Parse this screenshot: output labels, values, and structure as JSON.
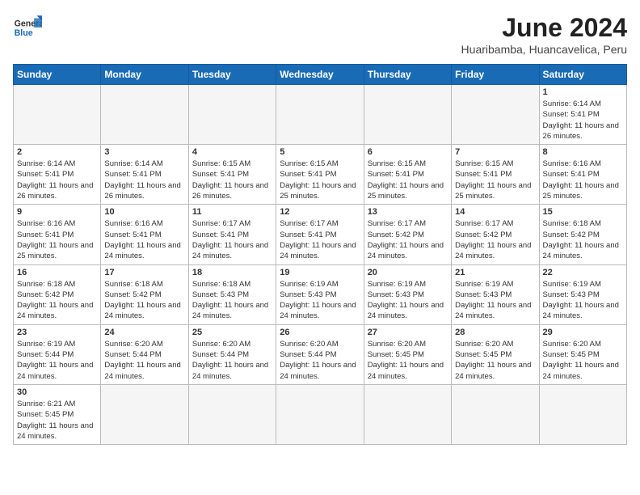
{
  "header": {
    "logo_general": "General",
    "logo_blue": "Blue",
    "month_year": "June 2024",
    "location": "Huaribamba, Huancavelica, Peru"
  },
  "weekdays": [
    "Sunday",
    "Monday",
    "Tuesday",
    "Wednesday",
    "Thursday",
    "Friday",
    "Saturday"
  ],
  "weeks": [
    [
      {
        "day": "",
        "info": ""
      },
      {
        "day": "",
        "info": ""
      },
      {
        "day": "",
        "info": ""
      },
      {
        "day": "",
        "info": ""
      },
      {
        "day": "",
        "info": ""
      },
      {
        "day": "",
        "info": ""
      },
      {
        "day": "1",
        "info": "Sunrise: 6:14 AM\nSunset: 5:41 PM\nDaylight: 11 hours\nand 26 minutes."
      }
    ],
    [
      {
        "day": "2",
        "info": "Sunrise: 6:14 AM\nSunset: 5:41 PM\nDaylight: 11 hours\nand 26 minutes."
      },
      {
        "day": "3",
        "info": "Sunrise: 6:14 AM\nSunset: 5:41 PM\nDaylight: 11 hours\nand 26 minutes."
      },
      {
        "day": "4",
        "info": "Sunrise: 6:15 AM\nSunset: 5:41 PM\nDaylight: 11 hours\nand 26 minutes."
      },
      {
        "day": "5",
        "info": "Sunrise: 6:15 AM\nSunset: 5:41 PM\nDaylight: 11 hours\nand 25 minutes."
      },
      {
        "day": "6",
        "info": "Sunrise: 6:15 AM\nSunset: 5:41 PM\nDaylight: 11 hours\nand 25 minutes."
      },
      {
        "day": "7",
        "info": "Sunrise: 6:15 AM\nSunset: 5:41 PM\nDaylight: 11 hours\nand 25 minutes."
      },
      {
        "day": "8",
        "info": "Sunrise: 6:16 AM\nSunset: 5:41 PM\nDaylight: 11 hours\nand 25 minutes."
      }
    ],
    [
      {
        "day": "9",
        "info": "Sunrise: 6:16 AM\nSunset: 5:41 PM\nDaylight: 11 hours\nand 25 minutes."
      },
      {
        "day": "10",
        "info": "Sunrise: 6:16 AM\nSunset: 5:41 PM\nDaylight: 11 hours\nand 24 minutes."
      },
      {
        "day": "11",
        "info": "Sunrise: 6:17 AM\nSunset: 5:41 PM\nDaylight: 11 hours\nand 24 minutes."
      },
      {
        "day": "12",
        "info": "Sunrise: 6:17 AM\nSunset: 5:41 PM\nDaylight: 11 hours\nand 24 minutes."
      },
      {
        "day": "13",
        "info": "Sunrise: 6:17 AM\nSunset: 5:42 PM\nDaylight: 11 hours\nand 24 minutes."
      },
      {
        "day": "14",
        "info": "Sunrise: 6:17 AM\nSunset: 5:42 PM\nDaylight: 11 hours\nand 24 minutes."
      },
      {
        "day": "15",
        "info": "Sunrise: 6:18 AM\nSunset: 5:42 PM\nDaylight: 11 hours\nand 24 minutes."
      }
    ],
    [
      {
        "day": "16",
        "info": "Sunrise: 6:18 AM\nSunset: 5:42 PM\nDaylight: 11 hours\nand 24 minutes."
      },
      {
        "day": "17",
        "info": "Sunrise: 6:18 AM\nSunset: 5:42 PM\nDaylight: 11 hours\nand 24 minutes."
      },
      {
        "day": "18",
        "info": "Sunrise: 6:18 AM\nSunset: 5:43 PM\nDaylight: 11 hours\nand 24 minutes."
      },
      {
        "day": "19",
        "info": "Sunrise: 6:19 AM\nSunset: 5:43 PM\nDaylight: 11 hours\nand 24 minutes."
      },
      {
        "day": "20",
        "info": "Sunrise: 6:19 AM\nSunset: 5:43 PM\nDaylight: 11 hours\nand 24 minutes."
      },
      {
        "day": "21",
        "info": "Sunrise: 6:19 AM\nSunset: 5:43 PM\nDaylight: 11 hours\nand 24 minutes."
      },
      {
        "day": "22",
        "info": "Sunrise: 6:19 AM\nSunset: 5:43 PM\nDaylight: 11 hours\nand 24 minutes."
      }
    ],
    [
      {
        "day": "23",
        "info": "Sunrise: 6:19 AM\nSunset: 5:44 PM\nDaylight: 11 hours\nand 24 minutes."
      },
      {
        "day": "24",
        "info": "Sunrise: 6:20 AM\nSunset: 5:44 PM\nDaylight: 11 hours\nand 24 minutes."
      },
      {
        "day": "25",
        "info": "Sunrise: 6:20 AM\nSunset: 5:44 PM\nDaylight: 11 hours\nand 24 minutes."
      },
      {
        "day": "26",
        "info": "Sunrise: 6:20 AM\nSunset: 5:44 PM\nDaylight: 11 hours\nand 24 minutes."
      },
      {
        "day": "27",
        "info": "Sunrise: 6:20 AM\nSunset: 5:45 PM\nDaylight: 11 hours\nand 24 minutes."
      },
      {
        "day": "28",
        "info": "Sunrise: 6:20 AM\nSunset: 5:45 PM\nDaylight: 11 hours\nand 24 minutes."
      },
      {
        "day": "29",
        "info": "Sunrise: 6:20 AM\nSunset: 5:45 PM\nDaylight: 11 hours\nand 24 minutes."
      }
    ],
    [
      {
        "day": "30",
        "info": "Sunrise: 6:21 AM\nSunset: 5:45 PM\nDaylight: 11 hours\nand 24 minutes."
      },
      {
        "day": "",
        "info": ""
      },
      {
        "day": "",
        "info": ""
      },
      {
        "day": "",
        "info": ""
      },
      {
        "day": "",
        "info": ""
      },
      {
        "day": "",
        "info": ""
      },
      {
        "day": "",
        "info": ""
      }
    ]
  ]
}
